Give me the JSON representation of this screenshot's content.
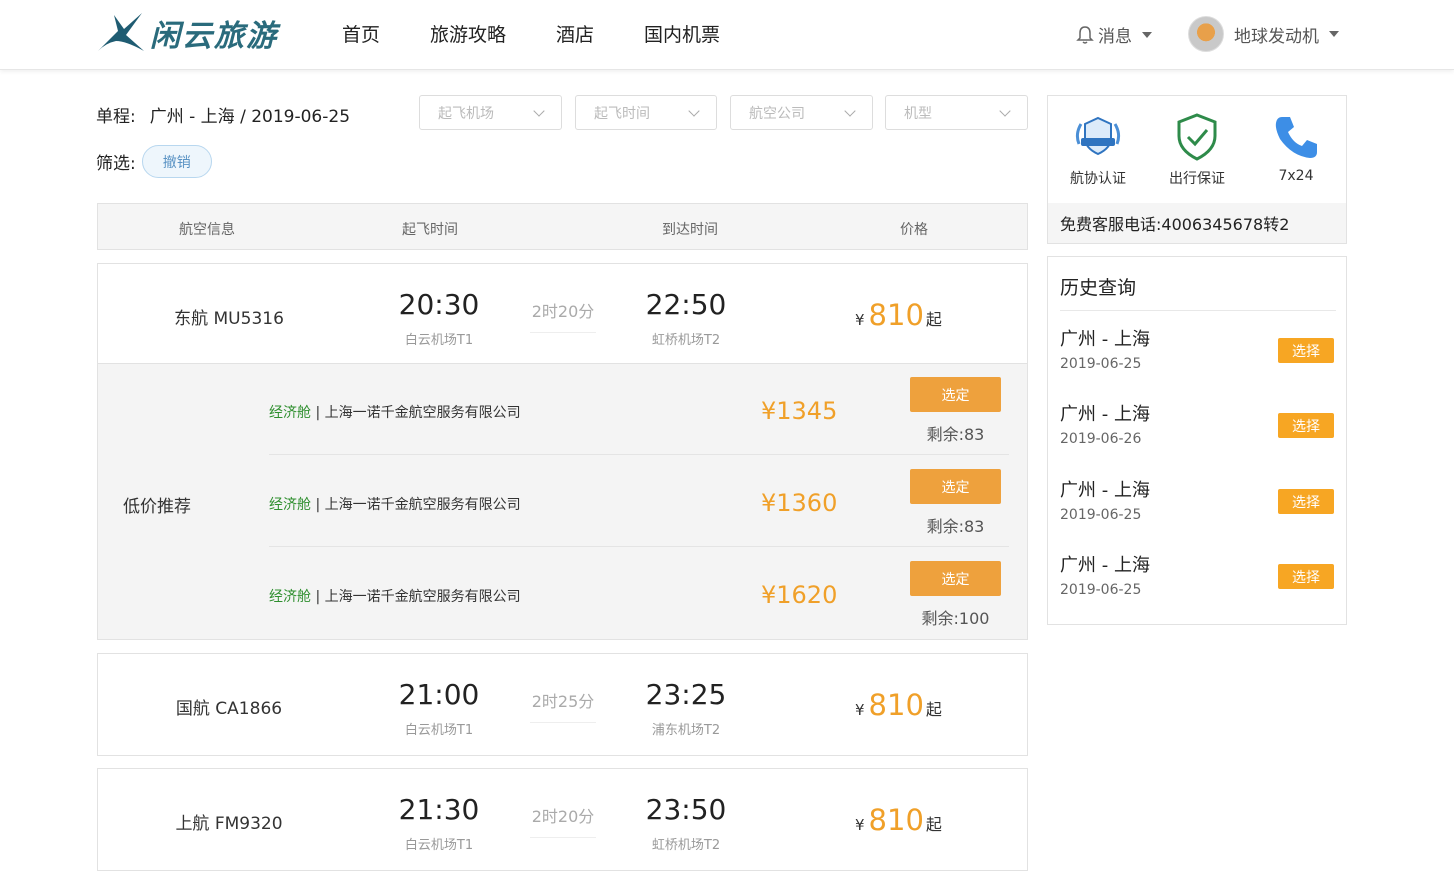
{
  "header": {
    "logo_text": "闲云旅游",
    "nav": [
      "首页",
      "旅游攻略",
      "酒店",
      "国内机票"
    ],
    "messages": "消息",
    "username": "地球发动机"
  },
  "search": {
    "label": "单程:",
    "route": "广州 - 上海 / 2019-06-25",
    "dropdowns": [
      "起飞机场",
      "起飞时间",
      "航空公司",
      "机型"
    ],
    "filter_label": "筛选:",
    "reset_tag": "撤销"
  },
  "table_header": {
    "info": "航空信息",
    "depart": "起飞时间",
    "arrive": "到达时间",
    "price": "价格"
  },
  "flights": [
    {
      "name": "东航 MU5316",
      "depart_time": "20:30",
      "depart_airport": "白云机场T1",
      "duration": "2时20分",
      "arrive_time": "22:50",
      "arrive_airport": "虹桥机场T2",
      "currency": "¥",
      "price": "810",
      "suffix": "起"
    },
    {
      "name": "国航 CA1866",
      "depart_time": "21:00",
      "depart_airport": "白云机场T1",
      "duration": "2时25分",
      "arrive_time": "23:25",
      "arrive_airport": "浦东机场T2",
      "currency": "¥",
      "price": "810",
      "suffix": "起"
    },
    {
      "name": "上航 FM9320",
      "depart_time": "21:30",
      "depart_airport": "白云机场T1",
      "duration": "2时20分",
      "arrive_time": "23:50",
      "arrive_airport": "虹桥机场T2",
      "currency": "¥",
      "price": "810",
      "suffix": "起"
    }
  ],
  "recommend": {
    "label": "低价推荐",
    "offers": [
      {
        "cabin": "经济舱",
        "sep": " | ",
        "agency": "上海一诺千金航空服务有限公司",
        "price": "¥1345",
        "button": "选定",
        "remain": "剩余:83"
      },
      {
        "cabin": "经济舱",
        "sep": " | ",
        "agency": "上海一诺千金航空服务有限公司",
        "price": "¥1360",
        "button": "选定",
        "remain": "剩余:83"
      },
      {
        "cabin": "经济舱",
        "sep": " | ",
        "agency": "上海一诺千金航空服务有限公司",
        "price": "¥1620",
        "button": "选定",
        "remain": "剩余:100"
      }
    ]
  },
  "service": {
    "badges": [
      {
        "label": "航协认证",
        "icon": "certified-badge-icon"
      },
      {
        "label": "出行保证",
        "icon": "shield-check-icon"
      },
      {
        "label": "7x24",
        "icon": "phone-icon"
      }
    ],
    "phone": "免费客服电话:4006345678转2",
    "accent": "#f7a623"
  },
  "history": {
    "title": "历史查询",
    "items": [
      {
        "route": "广州 - 上海",
        "date": "2019-06-25",
        "button": "选择"
      },
      {
        "route": "广州 - 上海",
        "date": "2019-06-26",
        "button": "选择"
      },
      {
        "route": "广州 - 上海",
        "date": "2019-06-25",
        "button": "选择"
      },
      {
        "route": "广州 - 上海",
        "date": "2019-06-25",
        "button": "选择"
      }
    ]
  }
}
